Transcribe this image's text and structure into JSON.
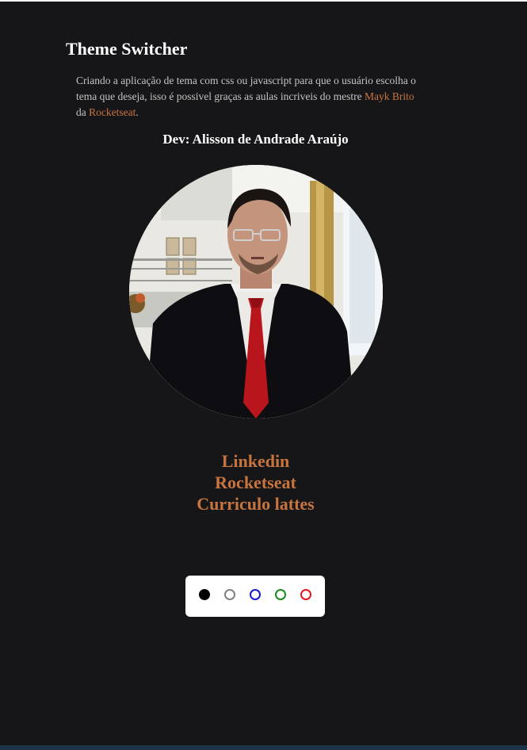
{
  "header": {
    "title": "Theme Switcher"
  },
  "intro": {
    "text_before": "Criando a aplicação de tema com css ou javascript para que o usuário escolha o tema que deseja, isso é possivel graças as aulas incriveis do mestre ",
    "link1": "Mayk Brito",
    "text_middle": " da ",
    "link2": "Rocketseat",
    "text_after": "."
  },
  "dev": {
    "label": "Dev: Alisson de Andrade Araújo"
  },
  "links": {
    "linkedin": "Linkedin",
    "rocketseat": "Rocketseat",
    "lattes": "Curriculo lattes"
  },
  "themes": [
    {
      "name": "black",
      "color": "#000000",
      "selected": true
    },
    {
      "name": "gray",
      "color": "#808080",
      "selected": false
    },
    {
      "name": "blue",
      "color": "#1a1acc",
      "selected": false
    },
    {
      "name": "green",
      "color": "#1a8a1a",
      "selected": false
    },
    {
      "name": "red",
      "color": "#e01a1a",
      "selected": false
    }
  ],
  "colors": {
    "background": "#161618",
    "accent": "#c8743e",
    "text": "#ffffff"
  }
}
